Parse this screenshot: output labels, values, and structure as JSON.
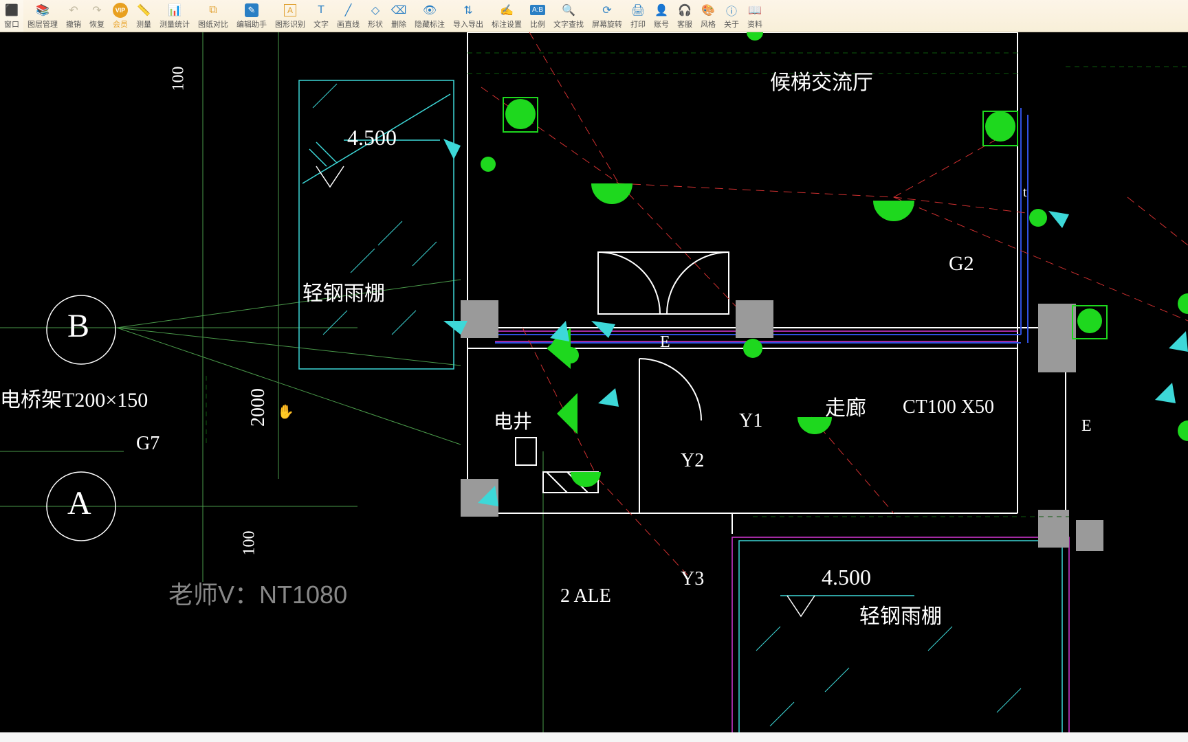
{
  "toolbar": [
    {
      "icon": "⬛",
      "color": "#2a7fc4",
      "label": "窗口",
      "name": "window-button"
    },
    {
      "icon": "📚",
      "color": "#2a7fc4",
      "label": "图层管理",
      "name": "layer-manager-button"
    },
    {
      "icon": "↶",
      "color": "#c0b8a0",
      "label": "撤销",
      "name": "undo-button"
    },
    {
      "icon": "↷",
      "color": "#c0b8a0",
      "label": "恢复",
      "name": "redo-button"
    },
    {
      "icon": "VIP",
      "color": "#e8a020",
      "label": "会员",
      "name": "vip-button"
    },
    {
      "icon": "📏",
      "color": "#2a7fc4",
      "label": "测量",
      "name": "measure-button"
    },
    {
      "icon": "📊",
      "color": "#e0a030",
      "label": "测量统计",
      "name": "measure-stats-button"
    },
    {
      "icon": "⧉",
      "color": "#e0a030",
      "label": "图纸对比",
      "name": "drawing-compare-button"
    },
    {
      "icon": "✎",
      "color": "#2a7fc4",
      "label": "编辑助手",
      "name": "edit-assistant-button"
    },
    {
      "icon": "A",
      "color": "#e0a030",
      "label": "图形识别",
      "name": "shape-recognition-button"
    },
    {
      "icon": "T",
      "color": "#2a7fc4",
      "label": "文字",
      "name": "text-button"
    },
    {
      "icon": "╱",
      "color": "#2a7fc4",
      "label": "画直线",
      "name": "draw-line-button"
    },
    {
      "icon": "◇",
      "color": "#2a7fc4",
      "label": "形状",
      "name": "shape-button"
    },
    {
      "icon": "⌫",
      "color": "#2a7fc4",
      "label": "删除",
      "name": "delete-button"
    },
    {
      "icon": "👁",
      "color": "#2a7fc4",
      "label": "隐藏标注",
      "name": "hide-annotation-button"
    },
    {
      "icon": "⇅",
      "color": "#2a7fc4",
      "label": "导入导出",
      "name": "import-export-button"
    },
    {
      "icon": "✍",
      "color": "#2a7fc4",
      "label": "标注设置",
      "name": "annotation-settings-button"
    },
    {
      "icon": "A:B",
      "color": "#2a7fc4",
      "label": "比例",
      "name": "scale-button"
    },
    {
      "icon": "🔍",
      "color": "#2a7fc4",
      "label": "文字查找",
      "name": "text-search-button"
    },
    {
      "icon": "⟳",
      "color": "#2a7fc4",
      "label": "屏幕旋转",
      "name": "screen-rotate-button"
    },
    {
      "icon": "🖨",
      "color": "#2a7fc4",
      "label": "打印",
      "name": "print-button"
    },
    {
      "icon": "👤",
      "color": "#2a7fc4",
      "label": "账号",
      "name": "account-button"
    },
    {
      "icon": "🎧",
      "color": "#2a7fc4",
      "label": "客服",
      "name": "support-button"
    },
    {
      "icon": "🎨",
      "color": "#2a7fc4",
      "label": "风格",
      "name": "style-button"
    },
    {
      "icon": "ⓘ",
      "color": "#2a7fc4",
      "label": "关于",
      "name": "about-button"
    },
    {
      "icon": "📖",
      "color": "#2a7fc4",
      "label": "资料",
      "name": "docs-button"
    }
  ],
  "drawing": {
    "grid_letters": {
      "B": "B",
      "A": "A"
    },
    "dimensions": {
      "d100a": "100",
      "d2000": "2000",
      "d100b": "100"
    },
    "labels": {
      "elev1": "4.500",
      "elev2": "4.500",
      "canopy1": "轻钢雨棚",
      "canopy2": "轻钢雨棚",
      "bridge": "电桥架T200×150",
      "g7": "G7",
      "g2": "G2",
      "ct": "CT100 X50",
      "e1": "E",
      "e2": "E",
      "corridor": "走廊",
      "elec_well": "电井",
      "y1": "Y1",
      "y2": "Y2",
      "y3": "Y3",
      "ale": "2 ALE",
      "t": "t",
      "top_text": "候梯交流厅"
    },
    "watermark": "老师V：NT1080"
  }
}
